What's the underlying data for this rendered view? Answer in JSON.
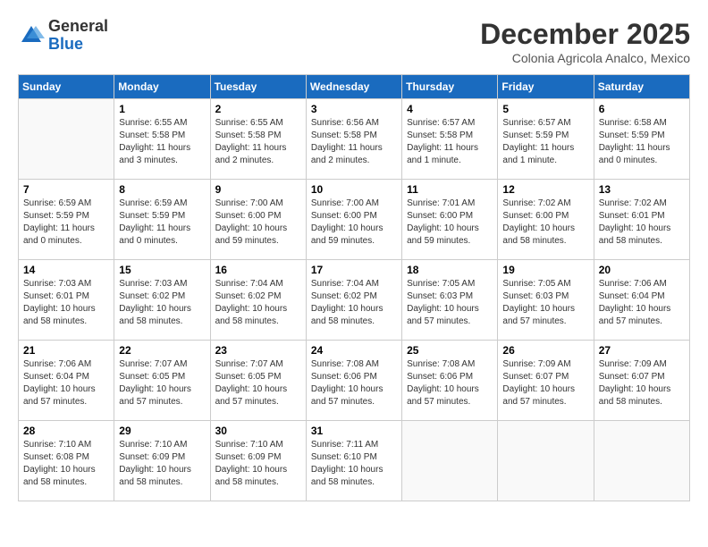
{
  "logo": {
    "general": "General",
    "blue": "Blue"
  },
  "header": {
    "month": "December 2025",
    "location": "Colonia Agricola Analco, Mexico"
  },
  "weekdays": [
    "Sunday",
    "Monday",
    "Tuesday",
    "Wednesday",
    "Thursday",
    "Friday",
    "Saturday"
  ],
  "weeks": [
    [
      {
        "day": "",
        "info": ""
      },
      {
        "day": "1",
        "info": "Sunrise: 6:55 AM\nSunset: 5:58 PM\nDaylight: 11 hours\nand 3 minutes."
      },
      {
        "day": "2",
        "info": "Sunrise: 6:55 AM\nSunset: 5:58 PM\nDaylight: 11 hours\nand 2 minutes."
      },
      {
        "day": "3",
        "info": "Sunrise: 6:56 AM\nSunset: 5:58 PM\nDaylight: 11 hours\nand 2 minutes."
      },
      {
        "day": "4",
        "info": "Sunrise: 6:57 AM\nSunset: 5:58 PM\nDaylight: 11 hours\nand 1 minute."
      },
      {
        "day": "5",
        "info": "Sunrise: 6:57 AM\nSunset: 5:59 PM\nDaylight: 11 hours\nand 1 minute."
      },
      {
        "day": "6",
        "info": "Sunrise: 6:58 AM\nSunset: 5:59 PM\nDaylight: 11 hours\nand 0 minutes."
      }
    ],
    [
      {
        "day": "7",
        "info": "Sunrise: 6:59 AM\nSunset: 5:59 PM\nDaylight: 11 hours\nand 0 minutes."
      },
      {
        "day": "8",
        "info": "Sunrise: 6:59 AM\nSunset: 5:59 PM\nDaylight: 11 hours\nand 0 minutes."
      },
      {
        "day": "9",
        "info": "Sunrise: 7:00 AM\nSunset: 6:00 PM\nDaylight: 10 hours\nand 59 minutes."
      },
      {
        "day": "10",
        "info": "Sunrise: 7:00 AM\nSunset: 6:00 PM\nDaylight: 10 hours\nand 59 minutes."
      },
      {
        "day": "11",
        "info": "Sunrise: 7:01 AM\nSunset: 6:00 PM\nDaylight: 10 hours\nand 59 minutes."
      },
      {
        "day": "12",
        "info": "Sunrise: 7:02 AM\nSunset: 6:00 PM\nDaylight: 10 hours\nand 58 minutes."
      },
      {
        "day": "13",
        "info": "Sunrise: 7:02 AM\nSunset: 6:01 PM\nDaylight: 10 hours\nand 58 minutes."
      }
    ],
    [
      {
        "day": "14",
        "info": "Sunrise: 7:03 AM\nSunset: 6:01 PM\nDaylight: 10 hours\nand 58 minutes."
      },
      {
        "day": "15",
        "info": "Sunrise: 7:03 AM\nSunset: 6:02 PM\nDaylight: 10 hours\nand 58 minutes."
      },
      {
        "day": "16",
        "info": "Sunrise: 7:04 AM\nSunset: 6:02 PM\nDaylight: 10 hours\nand 58 minutes."
      },
      {
        "day": "17",
        "info": "Sunrise: 7:04 AM\nSunset: 6:02 PM\nDaylight: 10 hours\nand 58 minutes."
      },
      {
        "day": "18",
        "info": "Sunrise: 7:05 AM\nSunset: 6:03 PM\nDaylight: 10 hours\nand 57 minutes."
      },
      {
        "day": "19",
        "info": "Sunrise: 7:05 AM\nSunset: 6:03 PM\nDaylight: 10 hours\nand 57 minutes."
      },
      {
        "day": "20",
        "info": "Sunrise: 7:06 AM\nSunset: 6:04 PM\nDaylight: 10 hours\nand 57 minutes."
      }
    ],
    [
      {
        "day": "21",
        "info": "Sunrise: 7:06 AM\nSunset: 6:04 PM\nDaylight: 10 hours\nand 57 minutes."
      },
      {
        "day": "22",
        "info": "Sunrise: 7:07 AM\nSunset: 6:05 PM\nDaylight: 10 hours\nand 57 minutes."
      },
      {
        "day": "23",
        "info": "Sunrise: 7:07 AM\nSunset: 6:05 PM\nDaylight: 10 hours\nand 57 minutes."
      },
      {
        "day": "24",
        "info": "Sunrise: 7:08 AM\nSunset: 6:06 PM\nDaylight: 10 hours\nand 57 minutes."
      },
      {
        "day": "25",
        "info": "Sunrise: 7:08 AM\nSunset: 6:06 PM\nDaylight: 10 hours\nand 57 minutes."
      },
      {
        "day": "26",
        "info": "Sunrise: 7:09 AM\nSunset: 6:07 PM\nDaylight: 10 hours\nand 57 minutes."
      },
      {
        "day": "27",
        "info": "Sunrise: 7:09 AM\nSunset: 6:07 PM\nDaylight: 10 hours\nand 58 minutes."
      }
    ],
    [
      {
        "day": "28",
        "info": "Sunrise: 7:10 AM\nSunset: 6:08 PM\nDaylight: 10 hours\nand 58 minutes."
      },
      {
        "day": "29",
        "info": "Sunrise: 7:10 AM\nSunset: 6:09 PM\nDaylight: 10 hours\nand 58 minutes."
      },
      {
        "day": "30",
        "info": "Sunrise: 7:10 AM\nSunset: 6:09 PM\nDaylight: 10 hours\nand 58 minutes."
      },
      {
        "day": "31",
        "info": "Sunrise: 7:11 AM\nSunset: 6:10 PM\nDaylight: 10 hours\nand 58 minutes."
      },
      {
        "day": "",
        "info": ""
      },
      {
        "day": "",
        "info": ""
      },
      {
        "day": "",
        "info": ""
      }
    ]
  ]
}
